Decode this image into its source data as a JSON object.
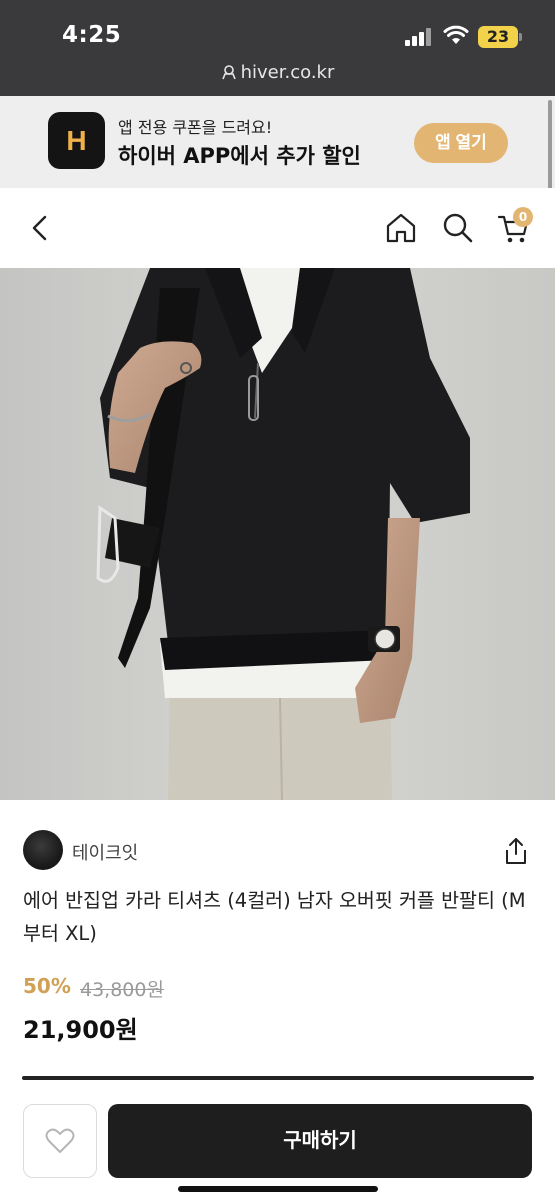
{
  "status_bar": {
    "time": "4:25",
    "battery": "23"
  },
  "browser": {
    "url": "hiver.co.kr"
  },
  "app_banner": {
    "logo_letter": "H",
    "subtitle": "앱 전용 쿠폰을 드려요!",
    "title": "하이버 APP에서 추가 할인",
    "open_button": "앱 열기"
  },
  "nav": {
    "cart_count": "0"
  },
  "product": {
    "seller_name": "테이크잇",
    "title": "에어 반집업 카라 티셔츠 (4컬러) 남자 오버핏 커플 반팔티 (M부터 XL)",
    "discount": "50%",
    "original_price": "43,800원",
    "price": "21,900원"
  },
  "bottom_bar": {
    "buy_button": "구매하기"
  },
  "colors": {
    "accent": "#e2b672",
    "discount": "#d0a055",
    "buy_button": "#1e1e1e"
  },
  "icons": [
    "lock-icon",
    "signal-icon",
    "wifi-icon",
    "back-icon",
    "home-icon",
    "search-icon",
    "cart-icon",
    "share-icon",
    "heart-icon"
  ]
}
